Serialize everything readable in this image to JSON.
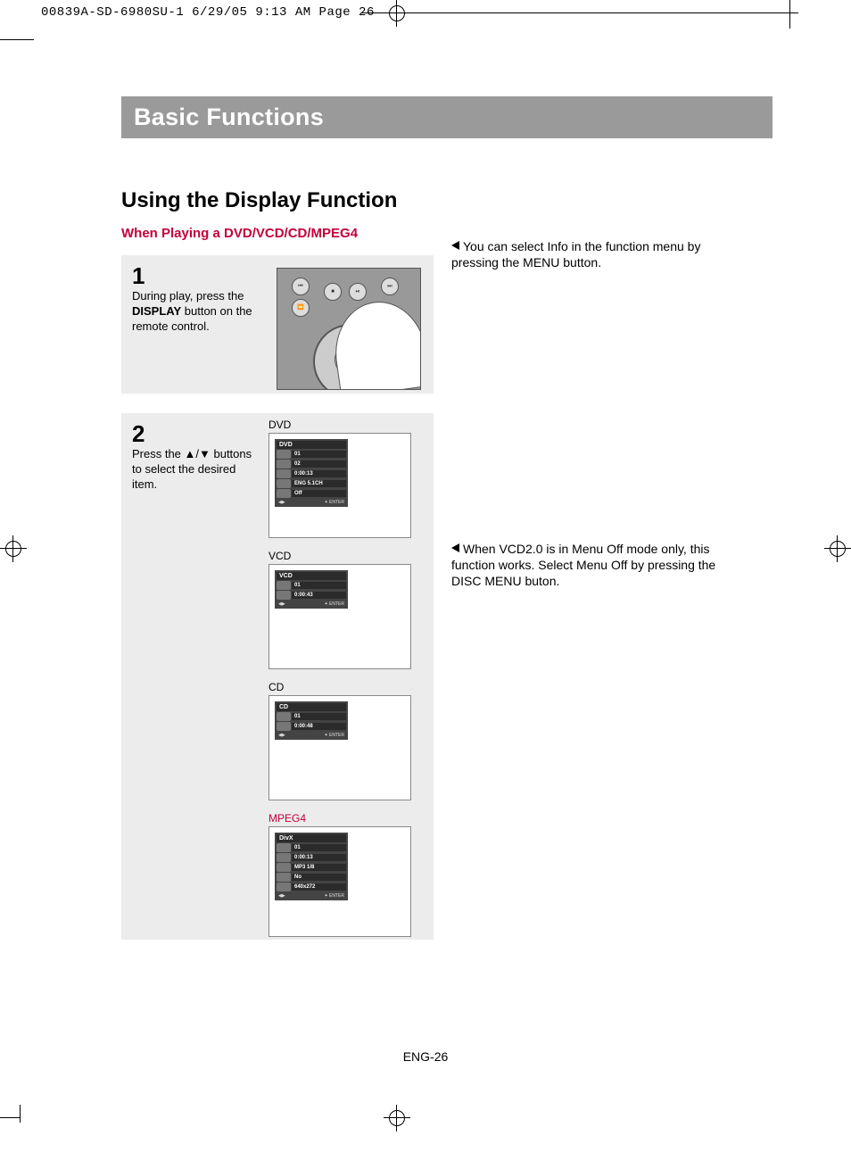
{
  "crop": {
    "header": "00839A-SD-6980SU-1  6/29/05  9:13 AM  Page 26"
  },
  "banner": "Basic Functions",
  "section_head": "Using the Display Function",
  "sub_head": "When Playing a DVD/VCD/CD/MPEG4",
  "step1": {
    "num": "1",
    "text_before": "During play, press the ",
    "bold": "DISPLAY",
    "text_after": " button on the remote control."
  },
  "step2": {
    "num": "2",
    "text": "Press the ▲/▼ buttons to select the desired item."
  },
  "note1": "You can select Info in the function menu by pressing the MENU button.",
  "note2": "When VCD2.0 is in Menu Off mode only, this function works. Select Menu Off by pressing the DISC MENU buton.",
  "osd": {
    "dvd": {
      "label": "DVD",
      "title": "DVD",
      "rows": [
        {
          "icon": "Title",
          "val": "01"
        },
        {
          "icon": "Chapter",
          "val": "02"
        },
        {
          "icon": "Time",
          "val": "0:00:13"
        },
        {
          "icon": "Audio",
          "val": "ENG 5.1CH"
        },
        {
          "icon": "Subtitle",
          "val": "Off"
        }
      ],
      "footer_left": "◀▶",
      "footer_right": "✦ ENTER"
    },
    "vcd": {
      "label": "VCD",
      "title": "VCD",
      "rows": [
        {
          "icon": "Track",
          "val": "01"
        },
        {
          "icon": "Time",
          "val": "0:00:43"
        }
      ],
      "footer_left": "◀▶",
      "footer_right": "✦ ENTER"
    },
    "cd": {
      "label": "CD",
      "title": "CD",
      "rows": [
        {
          "icon": "Track",
          "val": "01"
        },
        {
          "icon": "Time",
          "val": "0:00:48"
        }
      ],
      "footer_left": "◀▶",
      "footer_right": "✦ ENTER"
    },
    "mpeg4": {
      "label": "MPEG4",
      "title": "DivX",
      "rows": [
        {
          "icon": "Title",
          "val": "01"
        },
        {
          "icon": "Time",
          "val": "0:00:13"
        },
        {
          "icon": "Audio",
          "val": "MP3 1/8"
        },
        {
          "icon": "Subtitle",
          "val": "No"
        },
        {
          "icon": "Size",
          "val": "640x272"
        }
      ],
      "footer_left": "◀▶",
      "footer_right": "✦ ENTER"
    }
  },
  "page_foot": "ENG-26"
}
